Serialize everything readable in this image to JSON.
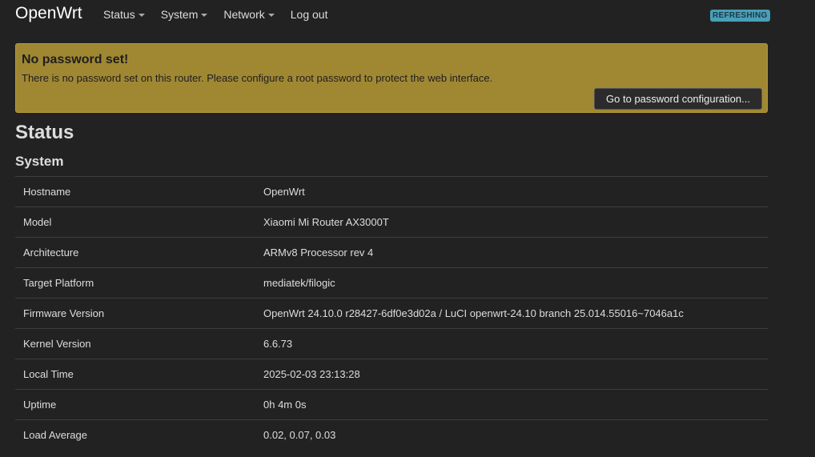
{
  "header": {
    "brand": "OpenWrt",
    "menu": [
      {
        "label": "Status",
        "has_dropdown": true
      },
      {
        "label": "System",
        "has_dropdown": true
      },
      {
        "label": "Network",
        "has_dropdown": true
      },
      {
        "label": "Log out",
        "has_dropdown": false
      }
    ],
    "status_badge": "REFRESHING"
  },
  "alert": {
    "title": "No password set!",
    "message": "There is no password set on this router. Please configure a root password to protect the web interface.",
    "button_label": "Go to password configuration..."
  },
  "page": {
    "title": "Status",
    "section_title": "System"
  },
  "system_table": {
    "rows": [
      {
        "key": "Hostname",
        "value": "OpenWrt"
      },
      {
        "key": "Model",
        "value": "Xiaomi Mi Router AX3000T"
      },
      {
        "key": "Architecture",
        "value": "ARMv8 Processor rev 4"
      },
      {
        "key": "Target Platform",
        "value": "mediatek/filogic"
      },
      {
        "key": "Firmware Version",
        "value": "OpenWrt 24.10.0 r28427-6df0e3d02a / LuCI openwrt-24.10 branch 25.014.55016~7046a1c"
      },
      {
        "key": "Kernel Version",
        "value": "6.6.73"
      },
      {
        "key": "Local Time",
        "value": "2025-02-03 23:13:28"
      },
      {
        "key": "Uptime",
        "value": "0h 4m 0s"
      },
      {
        "key": "Load Average",
        "value": "0.02, 0.07, 0.03"
      }
    ]
  },
  "colors": {
    "background": "#222222",
    "alert_background": "#a08833",
    "badge_background": "#4a9fb8"
  }
}
